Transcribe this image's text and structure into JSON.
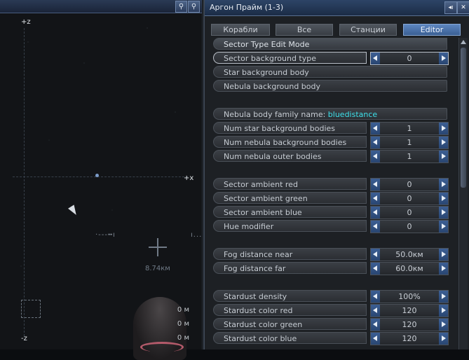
{
  "map": {
    "axis_plus_z": "+z",
    "axis_minus_z": "-z",
    "axis_plus_x": "+x",
    "target_distance": "8.74км",
    "ranges": [
      "0 м",
      "0 м",
      "0 м"
    ],
    "ticks_left": "·---╍ı",
    "ticks_right": "ı..."
  },
  "panel": {
    "title": "Аргон Прайм (1-3)",
    "tabs": [
      {
        "label": "Корабли",
        "active": false
      },
      {
        "label": "Все",
        "active": false
      },
      {
        "label": "Станции",
        "active": false
      },
      {
        "label": "Editor",
        "active": true
      }
    ],
    "rows": [
      {
        "label": "Sector Type Edit Mode",
        "kind": "head"
      },
      {
        "label": "Sector background type",
        "value": "0",
        "selected": true
      },
      {
        "label": "Star background body",
        "kind": "wide"
      },
      {
        "label": "Nebula background body",
        "kind": "wide"
      },
      {
        "label_prefix": "Nebula body family name: ",
        "label_accent": "bluedistance",
        "kind": "wide"
      },
      {
        "label": "Num star background bodies",
        "value": "1"
      },
      {
        "label": "Num nebula background bodies",
        "value": "1"
      },
      {
        "label": "Num nebula outer bodies",
        "value": "1"
      },
      {
        "label": "Sector ambient red",
        "value": "0"
      },
      {
        "label": "Sector ambient green",
        "value": "0"
      },
      {
        "label": "Sector ambient blue",
        "value": "0"
      },
      {
        "label": "Hue modifier",
        "value": "0"
      },
      {
        "label": "Fog distance near",
        "value": "50.0км"
      },
      {
        "label": "Fog distance far",
        "value": "60.0км"
      },
      {
        "label": "Stardust density",
        "value": "100%"
      },
      {
        "label": "Stardust color red",
        "value": "120"
      },
      {
        "label": "Stardust color green",
        "value": "120"
      },
      {
        "label": "Stardust color blue",
        "value": "120"
      }
    ]
  },
  "colors": {
    "accent_text": "#3ee0ea",
    "tab_active": "#4a73ab",
    "titlebar": "#2d4466"
  },
  "icons": [
    "search-icon",
    "zoom-icon",
    "sound-icon",
    "close-icon",
    "cursor-icon",
    "target-icon"
  ]
}
